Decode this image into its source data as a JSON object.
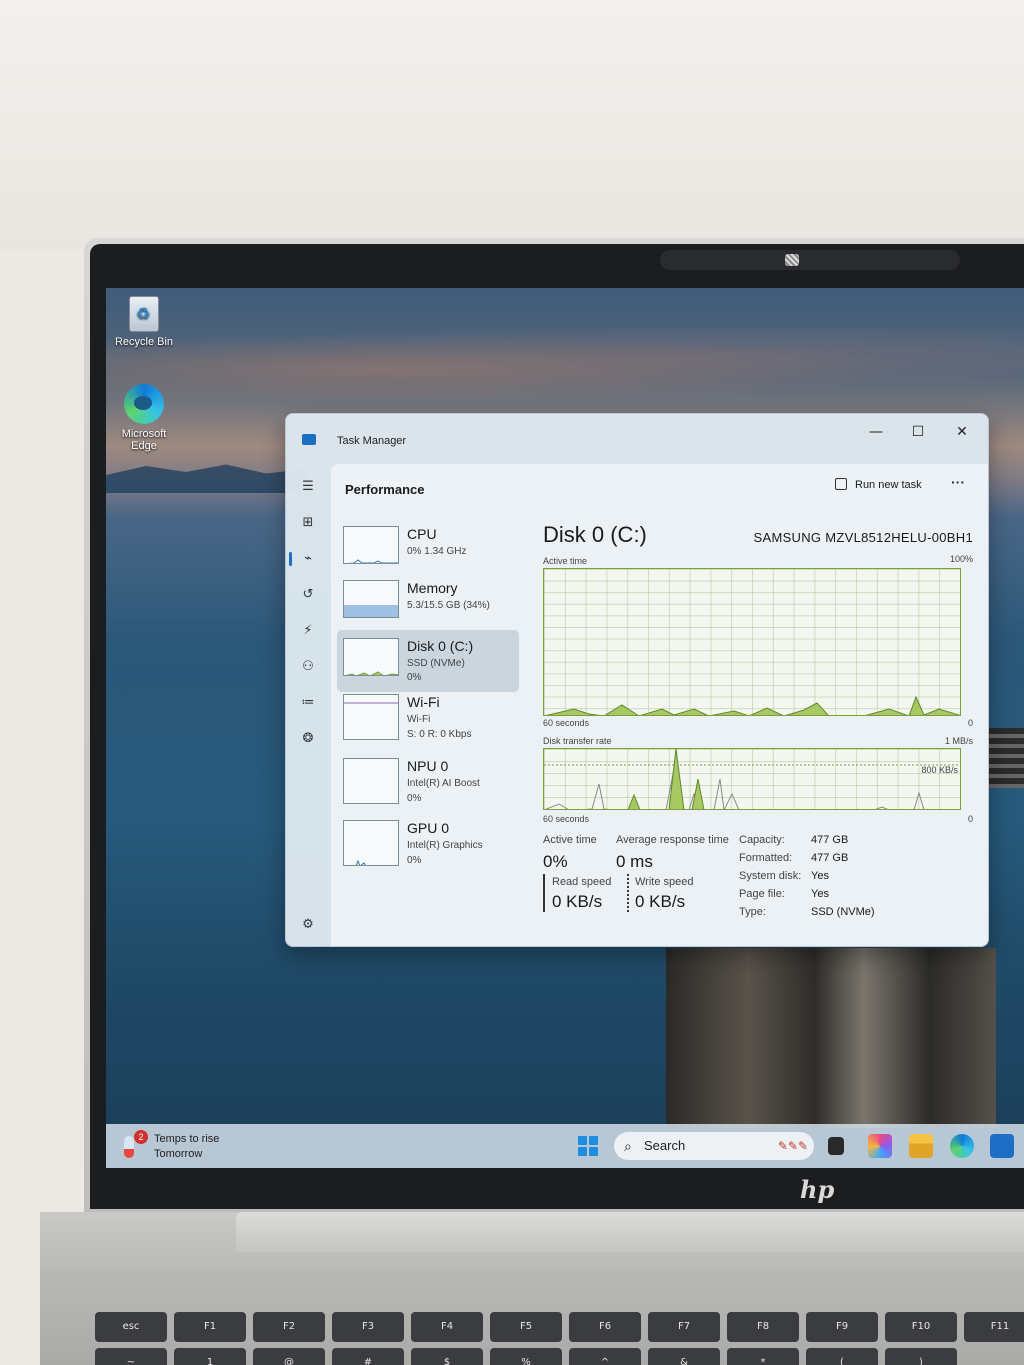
{
  "desktop": {
    "icons": [
      {
        "label": "Recycle Bin",
        "icon": "recycle-bin-icon"
      },
      {
        "label": "Microsoft Edge",
        "icon": "edge-icon"
      }
    ]
  },
  "taskbar": {
    "weather_line1": "Temps to rise",
    "weather_line2": "Tomorrow",
    "weather_badge": "2",
    "search_label": "Search",
    "apps": [
      "weather-icon",
      "start-icon",
      "search-icon",
      "task-view-icon",
      "copilot-icon",
      "file-explorer-icon",
      "edge-icon",
      "store-icon"
    ]
  },
  "window": {
    "app_title": "Task Manager",
    "controls": {
      "minimize": "—",
      "maximize": "☐",
      "close": "✕"
    },
    "nav": [
      "hamburger-icon",
      "processes-icon",
      "performance-icon",
      "app-history-icon",
      "startup-icon",
      "users-icon",
      "details-icon",
      "services-icon",
      "settings-icon"
    ],
    "header": {
      "title": "Performance",
      "run_new_task": "Run new task",
      "more": "···"
    },
    "resources": [
      {
        "name": "CPU",
        "sub1": "0% 1.34 GHz",
        "sub2": "",
        "sub3": "",
        "selected": false
      },
      {
        "name": "Memory",
        "sub1": "5.3/15.5 GB (34%)",
        "sub2": "",
        "sub3": "",
        "selected": false,
        "fill_fraction": 0.34
      },
      {
        "name": "Disk 0 (C:)",
        "sub1": "SSD (NVMe)",
        "sub2": "0%",
        "sub3": "",
        "selected": true
      },
      {
        "name": "Wi-Fi",
        "sub1": "Wi-Fi",
        "sub2": "S: 0 R: 0 Kbps",
        "sub3": "",
        "selected": false
      },
      {
        "name": "NPU 0",
        "sub1": "Intel(R) AI Boost",
        "sub2": "0%",
        "sub3": "",
        "selected": false
      },
      {
        "name": "GPU 0",
        "sub1": "Intel(R) Graphics",
        "sub2": "0%",
        "sub3": "",
        "selected": false
      }
    ],
    "detail": {
      "title": "Disk 0 (C:)",
      "model": "SAMSUNG MZVL8512HELU-00BH1",
      "graph1": {
        "label": "Active time",
        "max": "100%",
        "duration": "60 seconds",
        "min": "0"
      },
      "graph2": {
        "label": "Disk transfer rate",
        "max": "1 MB/s",
        "inner_max": "800 KB/s",
        "duration": "60 seconds",
        "min": "0"
      },
      "stats": {
        "active_time_label": "Active time",
        "active_time_value": "0%",
        "response_label": "Average response time",
        "response_value": "0 ms",
        "read_label": "Read speed",
        "read_value": "0 KB/s",
        "write_label": "Write speed",
        "write_value": "0 KB/s"
      },
      "props": [
        {
          "k": "Capacity:",
          "v": "477 GB"
        },
        {
          "k": "Formatted:",
          "v": "477 GB"
        },
        {
          "k": "System disk:",
          "v": "Yes"
        },
        {
          "k": "Page file:",
          "v": "Yes"
        },
        {
          "k": "Type:",
          "v": "SSD (NVMe)"
        }
      ]
    }
  },
  "keyboard": {
    "fn_row": [
      "esc",
      "F1",
      "F2",
      "F3",
      "F4",
      "F5",
      "F6",
      "F7",
      "F8",
      "F9",
      "F10",
      "F11"
    ],
    "num_row": [
      "~",
      "1",
      "@",
      "#",
      "$",
      "%",
      "^",
      "&",
      "*",
      "(",
      ")"
    ]
  },
  "device": {
    "logo": "hp"
  },
  "colors": {
    "accent": "#1a6fc4",
    "graph_line": "#7aa03a",
    "graph_fill": "#a8c864"
  }
}
